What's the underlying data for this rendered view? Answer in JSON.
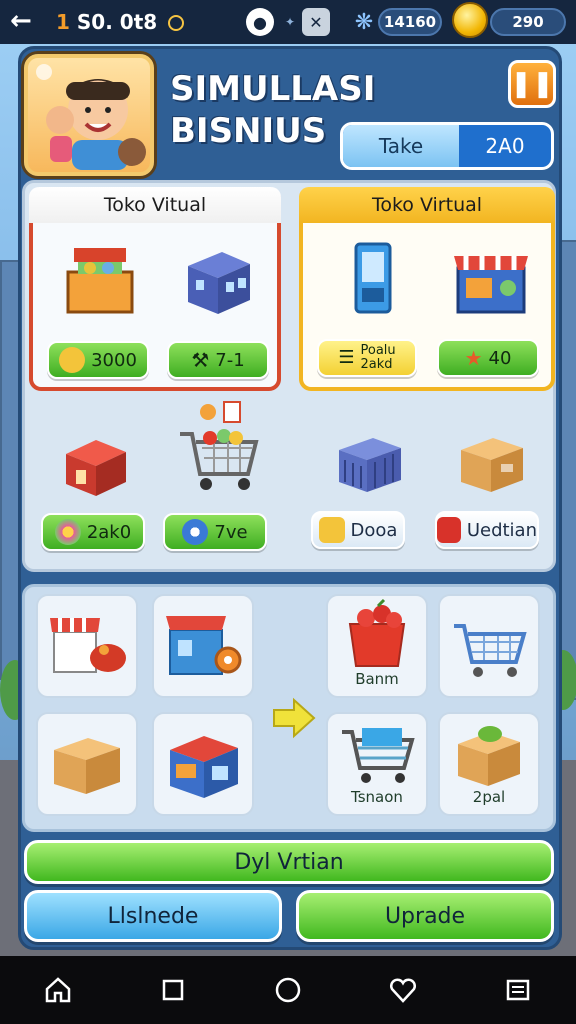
{
  "topbar": {
    "coins_prefix": "1",
    "coins_value": "S0. 0t8",
    "energy": "14160",
    "gold": "290"
  },
  "header": {
    "title_line1": "SIMULLASI",
    "title_line2": "BISNIUS",
    "toggle_left": "Take",
    "toggle_right": "2A0"
  },
  "cards": [
    {
      "title": "Toko Vitual",
      "badges": [
        {
          "label": "3000"
        },
        {
          "label": "7-1"
        }
      ]
    },
    {
      "title": "Toko Virtual",
      "badges": [
        {
          "label_line1": "Poalu",
          "label_line2": "2akd"
        },
        {
          "label": "40"
        }
      ]
    }
  ],
  "mid_badges": {
    "left": [
      "2ak0",
      "7ve"
    ],
    "right": [
      "Dooa",
      "Uedtian"
    ]
  },
  "slots": {
    "labels": [
      "Banm",
      "Tsnaon",
      "2pal"
    ]
  },
  "buttons": {
    "primary": "Dyl Vrtian",
    "left": "Llslnede",
    "right": "Uprade"
  },
  "colors": {
    "accent_green": "#41b81f",
    "accent_red": "#d64a2e",
    "accent_gold": "#f2b521",
    "accent_blue": "#3aa7e6"
  }
}
